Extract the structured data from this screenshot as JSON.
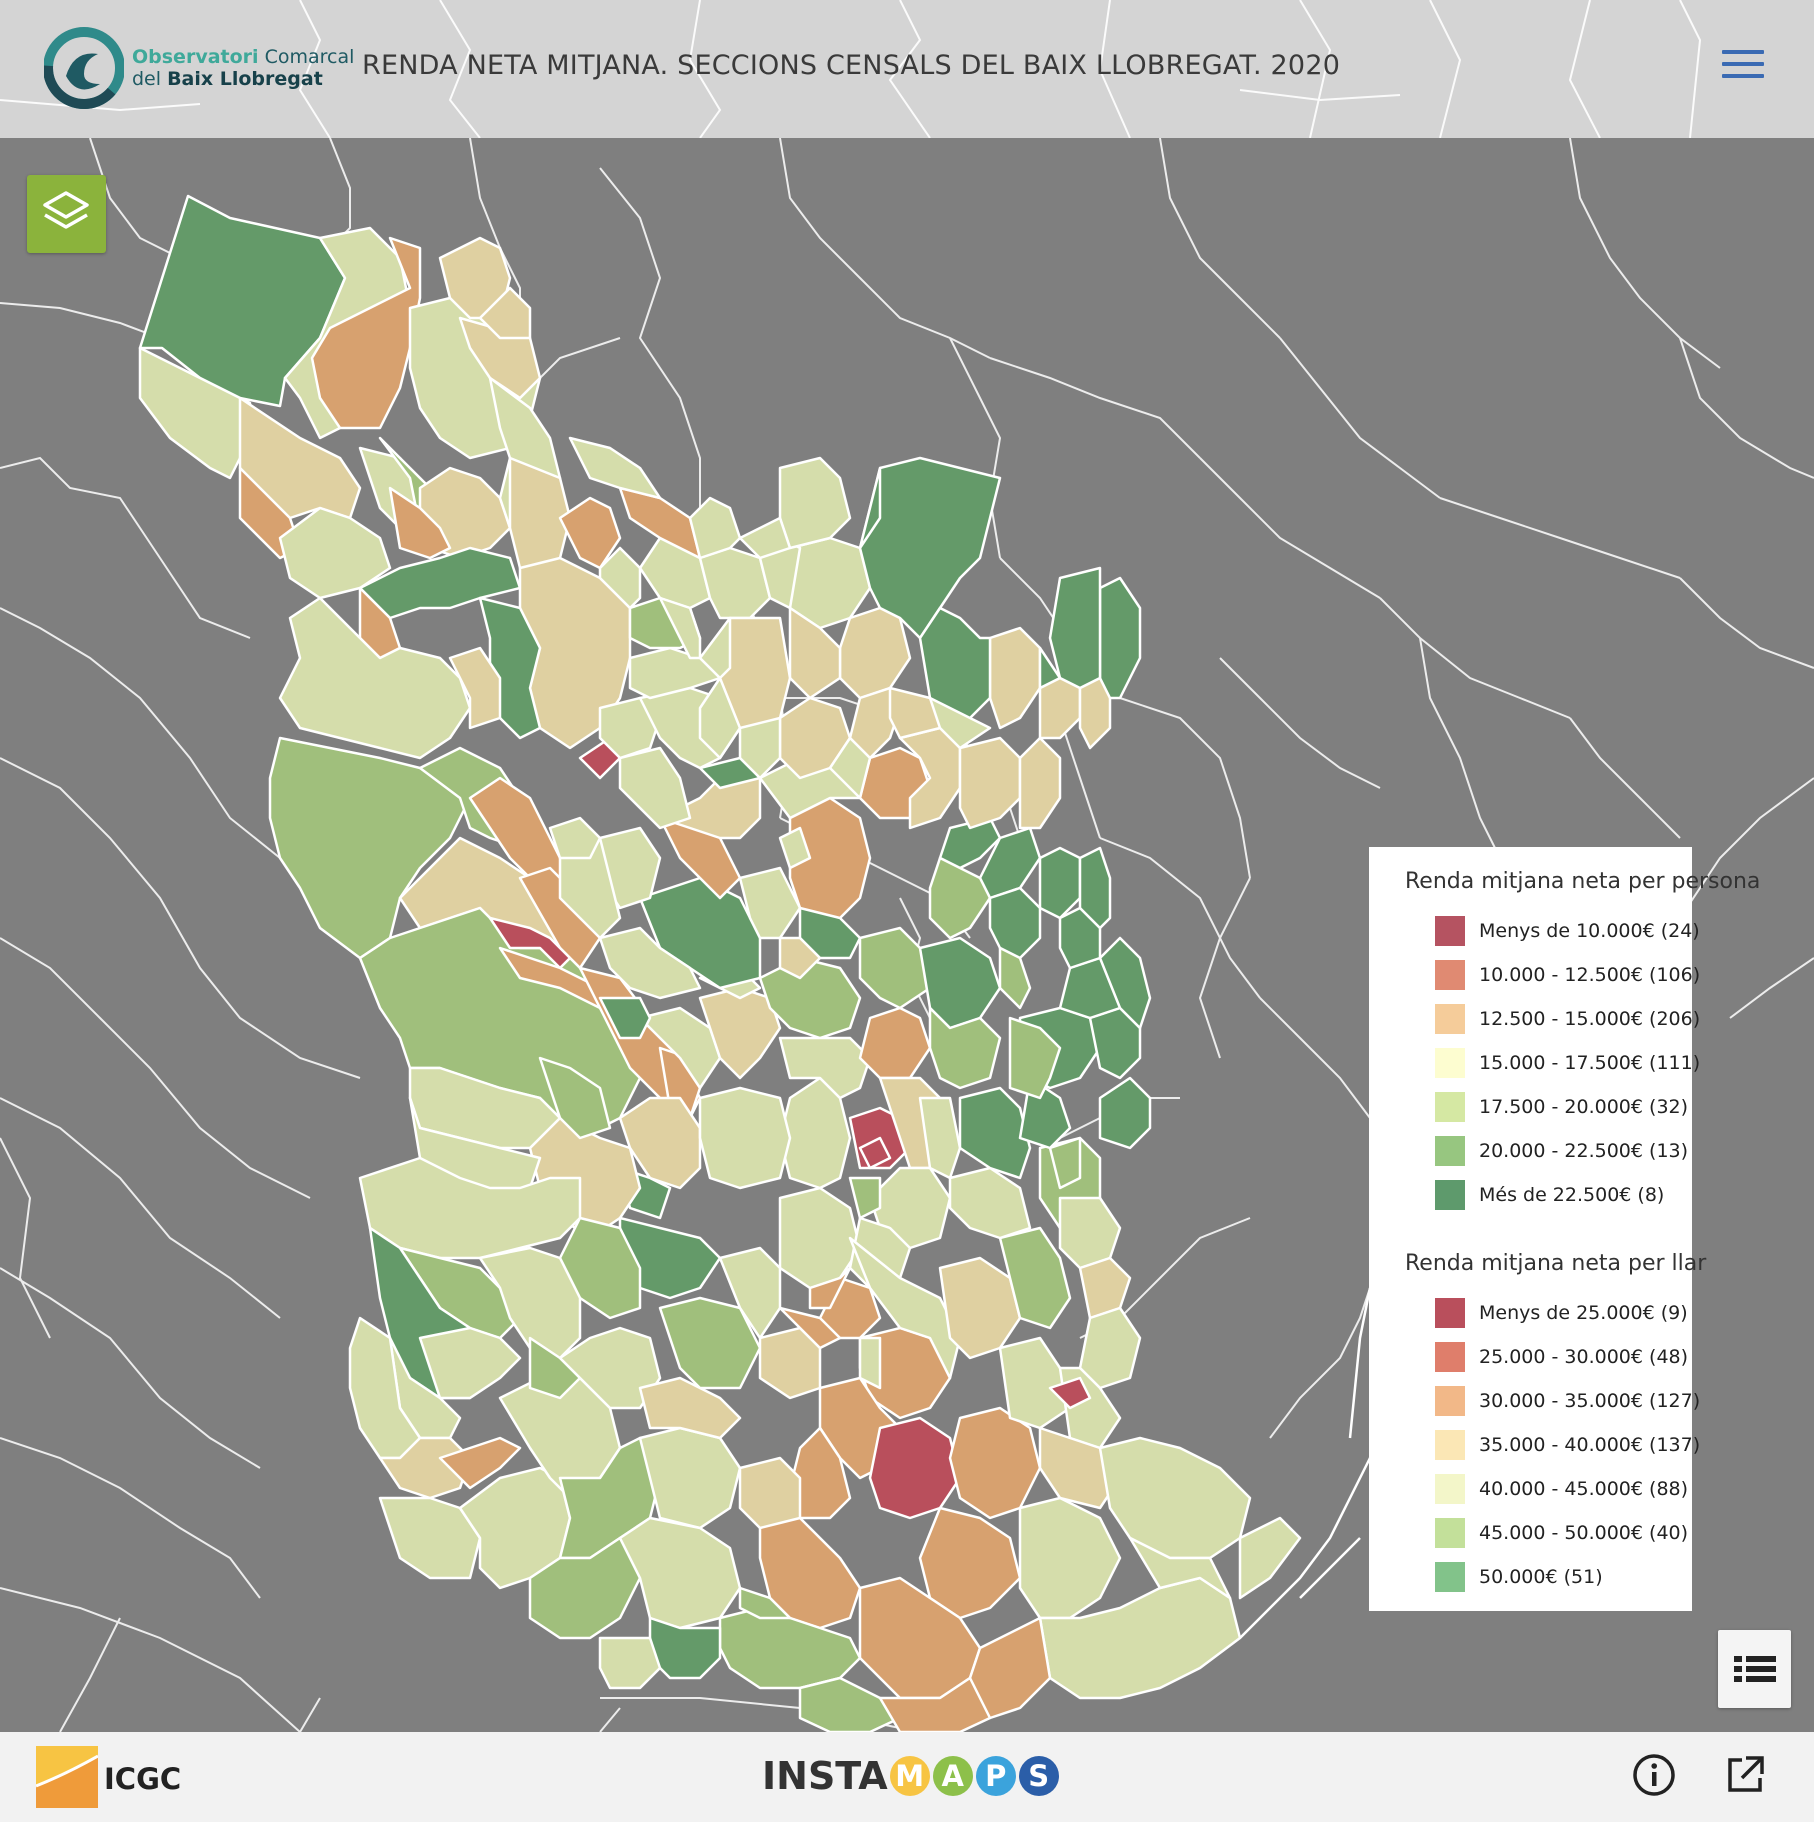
{
  "header": {
    "logo_line1_bold": "Observatori",
    "logo_line1_rest": "Comarcal",
    "logo_line2_rest": "del",
    "logo_line2_bold": "Baix Llobregat",
    "title": "RENDA NETA MITJANA. SECCIONS CENSALS DEL BAIX LLOBREGAT. 2020",
    "menu_icon": "hamburger-menu-icon"
  },
  "map_controls": {
    "layers_icon": "layers-icon",
    "legend_toggle_icon": "list-icon"
  },
  "legend": {
    "section1": {
      "title": "Renda mitjana neta per persona",
      "items": [
        {
          "label": "Menys de 10.000€ (24)",
          "color": "#b55361"
        },
        {
          "label": "10.000 - 12.500€ (106)",
          "color": "#e08a72"
        },
        {
          "label": "12.500 - 15.000€ (206)",
          "color": "#f5cc9a"
        },
        {
          "label": "15.000 - 17.500€ (111)",
          "color": "#fdfdd0"
        },
        {
          "label": "17.500 - 20.000€ (32)",
          "color": "#d5e8a3"
        },
        {
          "label": "20.000 - 22.500€ (13)",
          "color": "#97c680"
        },
        {
          "label": "Més de 22.500€ (8)",
          "color": "#5e9a6c"
        }
      ]
    },
    "section2": {
      "title": "Renda mitjana neta per llar",
      "items": [
        {
          "label": "Menys de 25.000€ (9)",
          "color": "#b94f5c"
        },
        {
          "label": "25.000 - 30.000€ (48)",
          "color": "#df7e6b"
        },
        {
          "label": "30.000 - 35.000€ (127)",
          "color": "#f2b888"
        },
        {
          "label": "35.000 - 40.000€ (137)",
          "color": "#fbe7b5"
        },
        {
          "label": "40.000 - 45.000€ (88)",
          "color": "#f3f6c9"
        },
        {
          "label": "45.000 - 50.000€ (40)",
          "color": "#c3e09a"
        },
        {
          "label": "50.000€ (51)",
          "color": "#82c38a"
        }
      ]
    }
  },
  "footer": {
    "icgc_label": "ICGC",
    "insta_word": "INSTA",
    "insta_letters": [
      {
        "letter": "M",
        "color": "#f7c443"
      },
      {
        "letter": "A",
        "color": "#8dc04a"
      },
      {
        "letter": "P",
        "color": "#3ba3dc"
      },
      {
        "letter": "S",
        "color": "#2b5ea8"
      }
    ],
    "info_icon": "info-icon",
    "external_link_icon": "external-link-icon"
  }
}
